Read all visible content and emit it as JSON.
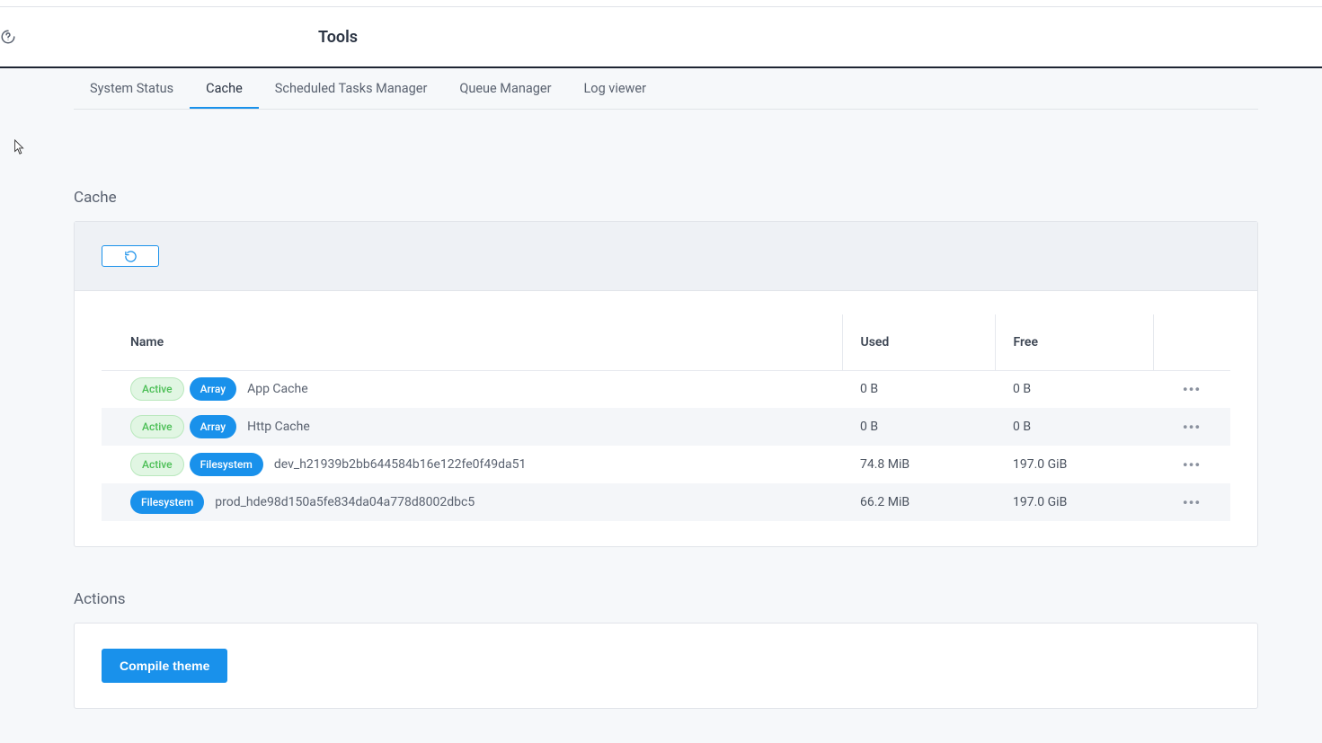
{
  "page": {
    "title": "Tools"
  },
  "tabs": [
    {
      "label": "System Status",
      "active": false
    },
    {
      "label": "Cache",
      "active": true
    },
    {
      "label": "Scheduled Tasks Manager",
      "active": false
    },
    {
      "label": "Queue Manager",
      "active": false
    },
    {
      "label": "Log viewer",
      "active": false
    }
  ],
  "cache": {
    "section_title": "Cache",
    "columns": {
      "name": "Name",
      "used": "Used",
      "free": "Free"
    },
    "badges": {
      "active": "Active",
      "array": "Array",
      "filesystem": "Filesystem"
    },
    "rows": [
      {
        "active": true,
        "type": "array",
        "name": "App Cache",
        "used": "0 B",
        "free": "0 B"
      },
      {
        "active": true,
        "type": "array",
        "name": "Http Cache",
        "used": "0 B",
        "free": "0 B"
      },
      {
        "active": true,
        "type": "filesystem",
        "name": "dev_h21939b2bb644584b16e122fe0f49da51",
        "used": "74.8 MiB",
        "free": "197.0 GiB"
      },
      {
        "active": false,
        "type": "filesystem",
        "name": "prod_hde98d150a5fe834da04a778d8002dbc5",
        "used": "66.2 MiB",
        "free": "197.0 GiB"
      }
    ]
  },
  "actions": {
    "section_title": "Actions",
    "compile_theme_label": "Compile theme"
  }
}
